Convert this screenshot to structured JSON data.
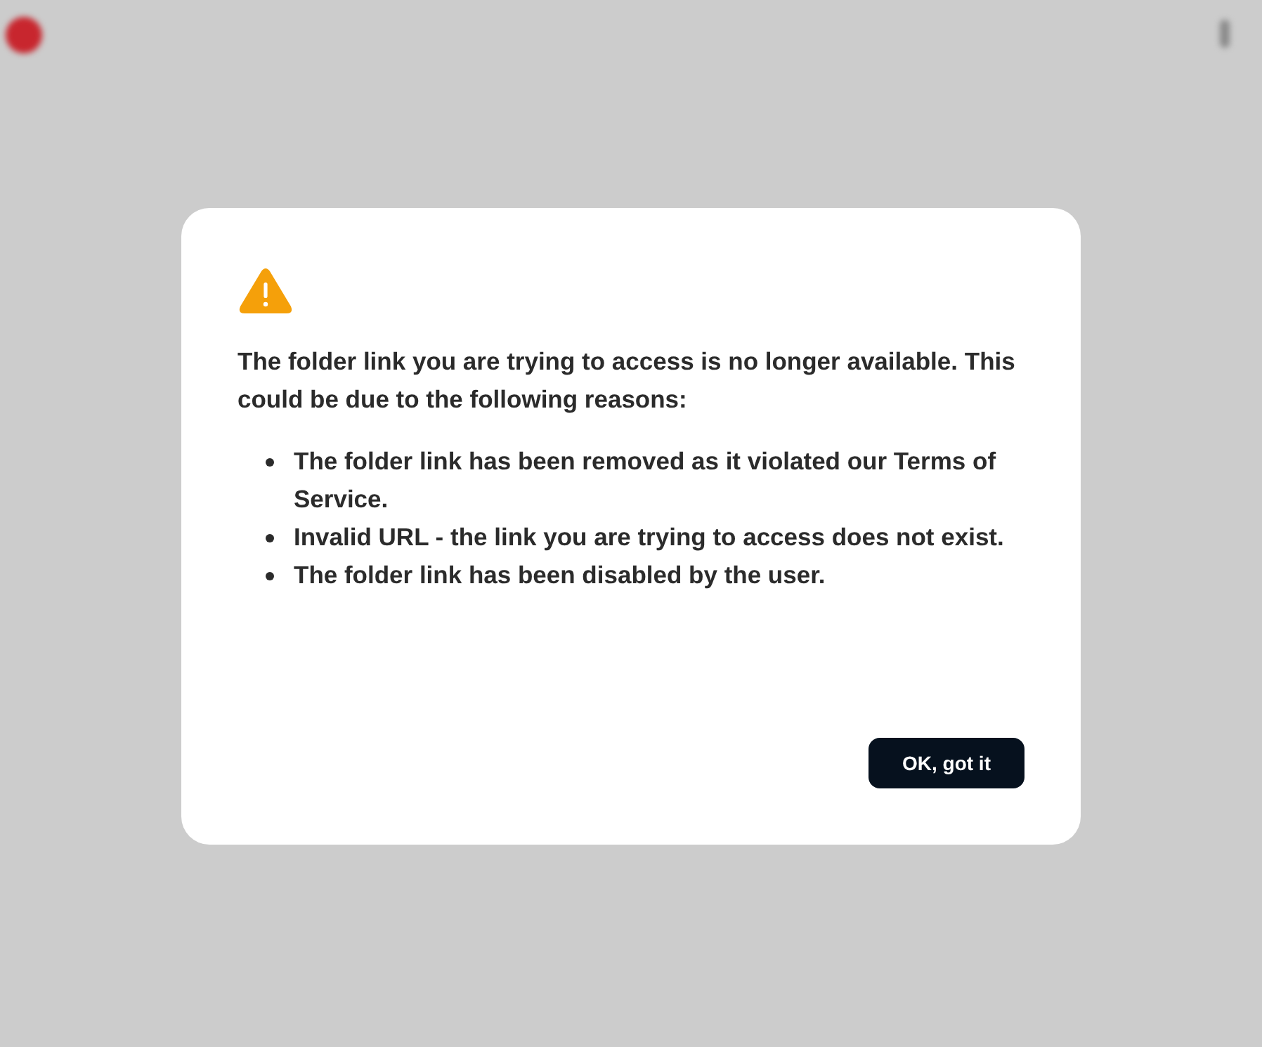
{
  "dialog": {
    "message": "The folder link you are trying to access is no longer available. This could be due to the following reasons:",
    "reasons": [
      "The folder link has been removed as it violated our Terms of Service.",
      "Invalid URL - the link you are trying to access does not exist.",
      "The folder link has been disabled by the user."
    ],
    "button": "OK, got it"
  }
}
